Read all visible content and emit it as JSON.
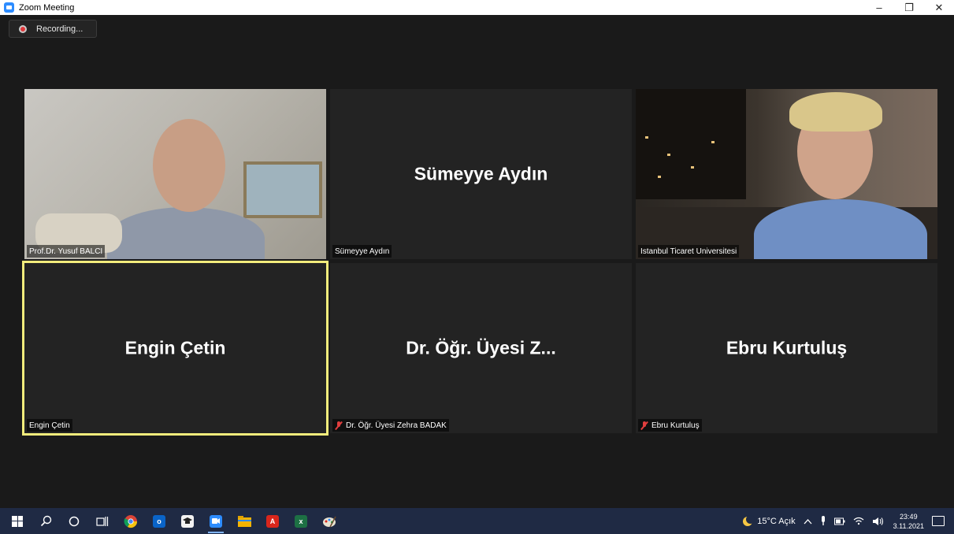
{
  "window": {
    "title": "Zoom Meeting",
    "minimize": "–",
    "maximize": "❐",
    "close": "✕"
  },
  "recording": {
    "label": "Recording..."
  },
  "participants": [
    {
      "center_name": "",
      "label": "Prof.Dr. Yusuf BALCI",
      "muted": false,
      "video": true
    },
    {
      "center_name": "Sümeyye Aydın",
      "label": "Sümeyye Aydın",
      "muted": false,
      "video": false
    },
    {
      "center_name": "",
      "label": "Istanbul Ticaret Universitesi",
      "muted": false,
      "video": true
    },
    {
      "center_name": "Engin Çetin",
      "label": "Engin Çetin",
      "muted": false,
      "video": false,
      "active_speaker": true
    },
    {
      "center_name": "Dr. Öğr. Üyesi Z...",
      "label": "Dr. Öğr. Üyesi Zehra BADAK",
      "muted": true,
      "video": false
    },
    {
      "center_name": "Ebru Kurtuluş",
      "label": "Ebru Kurtuluş",
      "muted": true,
      "video": false
    }
  ],
  "colors": {
    "active_speaker_border": "#f2ec7c",
    "tile_bg": "#232323",
    "meeting_bg": "#1a1a1a",
    "taskbar_bg": "#1f2a44",
    "muted_icon": "#e03e3e"
  },
  "taskbar": {
    "icons": [
      "windows-start-icon",
      "search-icon",
      "cortana-icon",
      "task-view-icon",
      "chrome-icon",
      "outlook-icon",
      "graduation-app-icon",
      "zoom-icon",
      "file-explorer-icon",
      "acrobat-icon",
      "excel-icon",
      "paint-icon"
    ],
    "outlook_text": "o",
    "excel_text": "x",
    "acrobat_text": "A",
    "weather": "15°C Açık",
    "time": "23:49",
    "date": "3.11.2021"
  }
}
